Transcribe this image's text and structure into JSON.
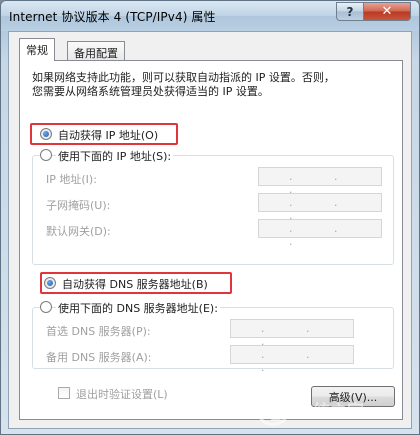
{
  "window": {
    "title": "Internet 协议版本 4 (TCP/IPv4) 属性",
    "help_glyph": "?",
    "close_glyph": "✕"
  },
  "tabs": [
    {
      "label": "常规",
      "selected": true
    },
    {
      "label": "备用配置",
      "selected": false
    }
  ],
  "description": {
    "line1": "如果网络支持此功能，则可以获取自动指派的 IP 设置。否则，",
    "line2": "您需要从网络系统管理员处获得适当的 IP 设置。"
  },
  "ip_section": {
    "auto_label": "自动获得 IP 地址(O)",
    "auto_selected": true,
    "manual_label": "使用下面的 IP 地址(S):",
    "manual_selected": false,
    "fields": [
      {
        "label": "IP 地址(I):",
        "value": ". . ."
      },
      {
        "label": "子网掩码(U):",
        "value": ". . ."
      },
      {
        "label": "默认网关(D):",
        "value": ". . ."
      }
    ]
  },
  "dns_section": {
    "auto_label": "自动获得 DNS 服务器地址(B)",
    "auto_selected": true,
    "manual_label": "使用下面的 DNS 服务器地址(E):",
    "manual_selected": false,
    "fields": [
      {
        "label": "首选 DNS 服务器(P):",
        "value": ". . ."
      },
      {
        "label": "备用 DNS 服务器(A):",
        "value": ". . ."
      }
    ]
  },
  "validate_checkbox": {
    "label": "退出时验证设置(L)",
    "checked": false
  },
  "advanced_button": {
    "label": "高级(V)..."
  },
  "watermark": {
    "text": "系统之家"
  },
  "colors": {
    "highlight_border": "#e0353b",
    "radio_dot": "#1e5fb8",
    "disabled_text": "#a0a0a0"
  }
}
